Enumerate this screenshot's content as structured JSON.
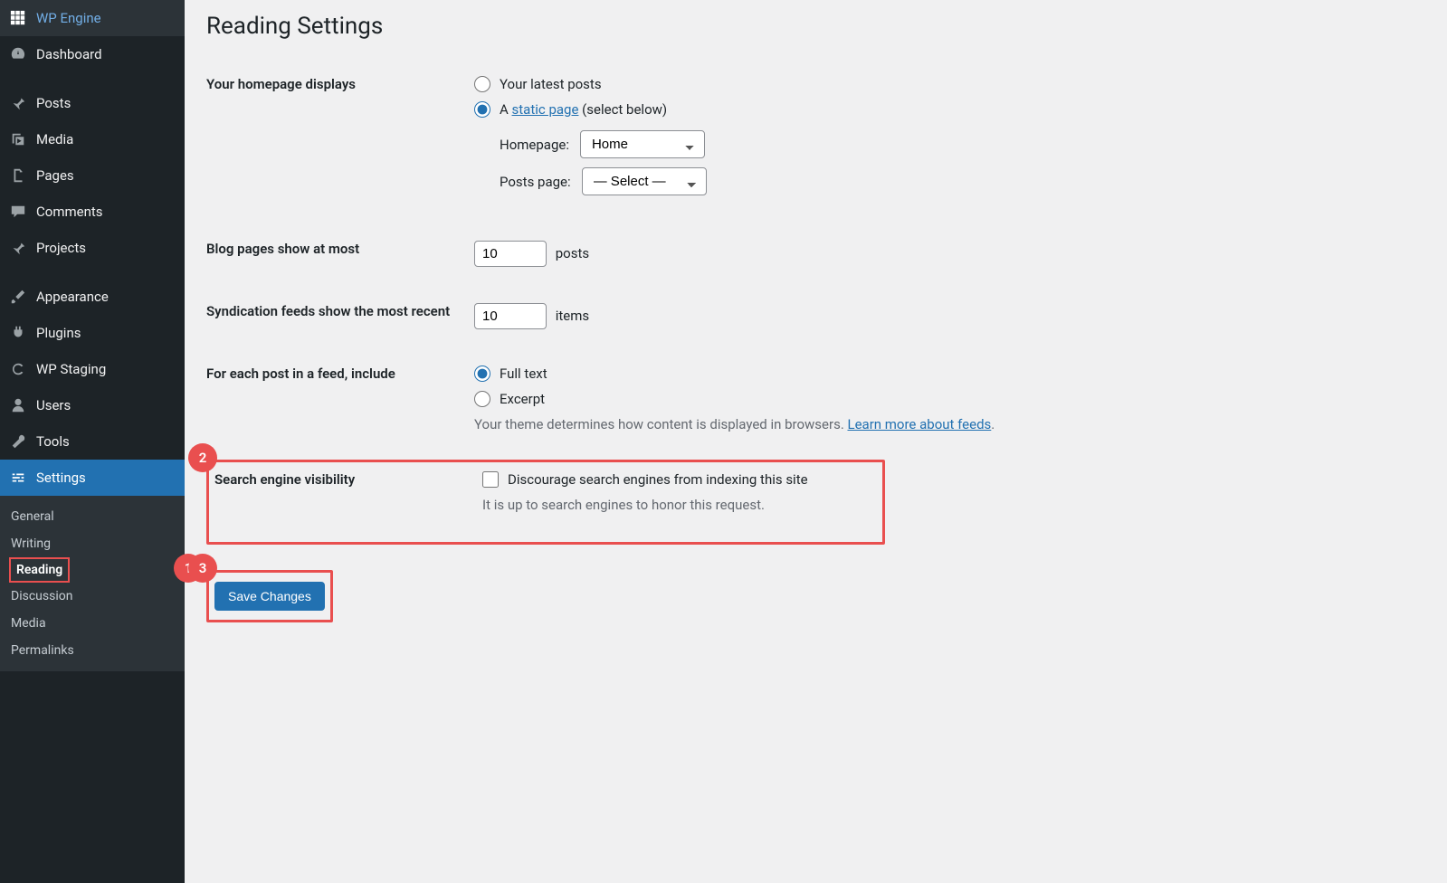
{
  "sidebar": {
    "items": [
      {
        "label": "WP Engine",
        "icon": "grid-icon"
      },
      {
        "label": "Dashboard",
        "icon": "gauge-icon"
      },
      {
        "label": "Posts",
        "icon": "pin-icon"
      },
      {
        "label": "Media",
        "icon": "media-icon"
      },
      {
        "label": "Pages",
        "icon": "page-icon"
      },
      {
        "label": "Comments",
        "icon": "comment-icon"
      },
      {
        "label": "Projects",
        "icon": "pin-icon"
      },
      {
        "label": "Appearance",
        "icon": "brush-icon"
      },
      {
        "label": "Plugins",
        "icon": "plug-icon"
      },
      {
        "label": "WP Staging",
        "icon": "refresh-icon"
      },
      {
        "label": "Users",
        "icon": "user-icon"
      },
      {
        "label": "Tools",
        "icon": "wrench-icon"
      },
      {
        "label": "Settings",
        "icon": "sliders-icon"
      }
    ],
    "sub": [
      "General",
      "Writing",
      "Reading",
      "Discussion",
      "Media",
      "Permalinks"
    ]
  },
  "page": {
    "title": "Reading Settings",
    "hp": {
      "label": "Your homepage displays",
      "opt_latest": "Your latest posts",
      "opt_static_prefix": "A ",
      "opt_static_link": "static page",
      "opt_static_suffix": " (select below)",
      "homepage_label": "Homepage:",
      "homepage_value": "Home",
      "postspage_label": "Posts page:",
      "postspage_value": "— Select —"
    },
    "blog_pages": {
      "label": "Blog pages show at most",
      "value": "10",
      "suffix": "posts"
    },
    "feeds": {
      "label": "Syndication feeds show the most recent",
      "value": "10",
      "suffix": "items"
    },
    "feed_include": {
      "label": "For each post in a feed, include",
      "opt_full": "Full text",
      "opt_excerpt": "Excerpt",
      "desc_pre": "Your theme determines how content is displayed in browsers. ",
      "desc_link": "Learn more about feeds",
      "desc_post": "."
    },
    "sev": {
      "label": "Search engine visibility",
      "checkbox": "Discourage search engines from indexing this site",
      "desc": "It is up to search engines to honor this request."
    },
    "save": "Save Changes"
  },
  "annotations": {
    "b1": "1",
    "b2": "2",
    "b3": "3"
  }
}
